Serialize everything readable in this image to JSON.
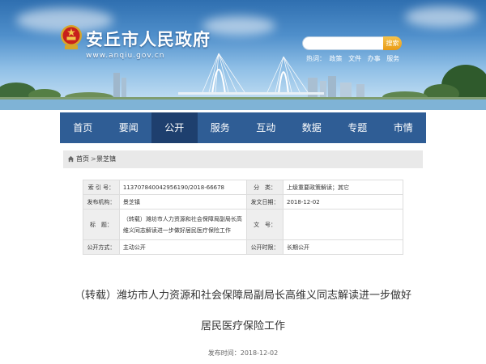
{
  "header": {
    "site_title": "安丘市人民政府",
    "site_url": "www.anqiu.gov.cn",
    "search": {
      "placeholder": "",
      "button_label": "搜索"
    },
    "hot_label": "热词：",
    "hot_words": [
      "政策",
      "文件",
      "办事",
      "服务"
    ]
  },
  "nav": {
    "items": [
      {
        "label": "首页"
      },
      {
        "label": "要闻"
      },
      {
        "label": "公开",
        "active": true
      },
      {
        "label": "服务"
      },
      {
        "label": "互动"
      },
      {
        "label": "数据"
      },
      {
        "label": "专题"
      },
      {
        "label": "市情"
      }
    ]
  },
  "breadcrumb": {
    "home": "首页",
    "separator": ">",
    "current": "景芝镇"
  },
  "meta": {
    "index_label": "索 引 号：",
    "index_value": "113707840042956190/2018-66678",
    "category_label": "分　类：",
    "category_value": "上级重要政策解读；其它",
    "publisher_label": "发布机构：",
    "publisher_value": "景芝镇",
    "date_label": "发文日期：",
    "date_value": "2018-12-02",
    "title_label": "标　题：",
    "title_value": "（转载）潍坊市人力资源和社会保障局副局长高维义同志解读进一步做好居民医疗保险工作",
    "docno_label": "文　号：",
    "docno_value": "",
    "method_label": "公开方式：",
    "method_value": "主动公开",
    "period_label": "公开时限：",
    "period_value": "长期公开"
  },
  "article": {
    "title": "（转载）潍坊市人力资源和社会保障局副局长高维义同志解读进一步做好居民医疗保险工作",
    "publish_time": "发布时间：2018-12-02"
  },
  "colors": {
    "nav_bg": "#2f5d95",
    "nav_active": "#1e3f6e",
    "search_button": "#e89a16"
  }
}
